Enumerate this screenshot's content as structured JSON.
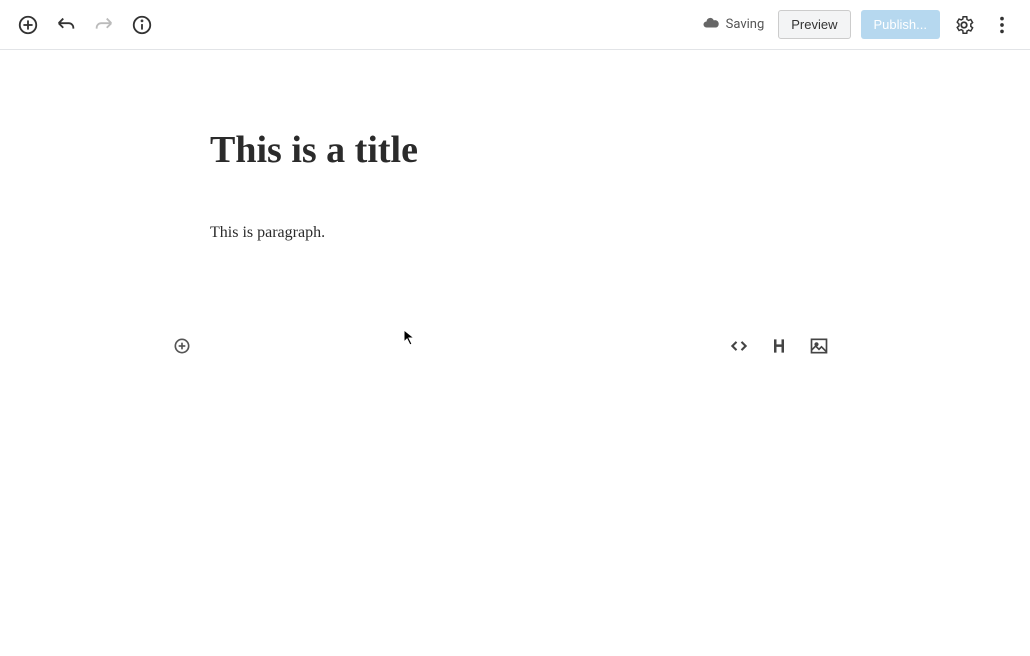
{
  "toolbar": {
    "saving_label": "Saving",
    "preview_label": "Preview",
    "publish_label": "Publish..."
  },
  "content": {
    "title": "This is a title",
    "paragraph": "This is paragraph."
  }
}
